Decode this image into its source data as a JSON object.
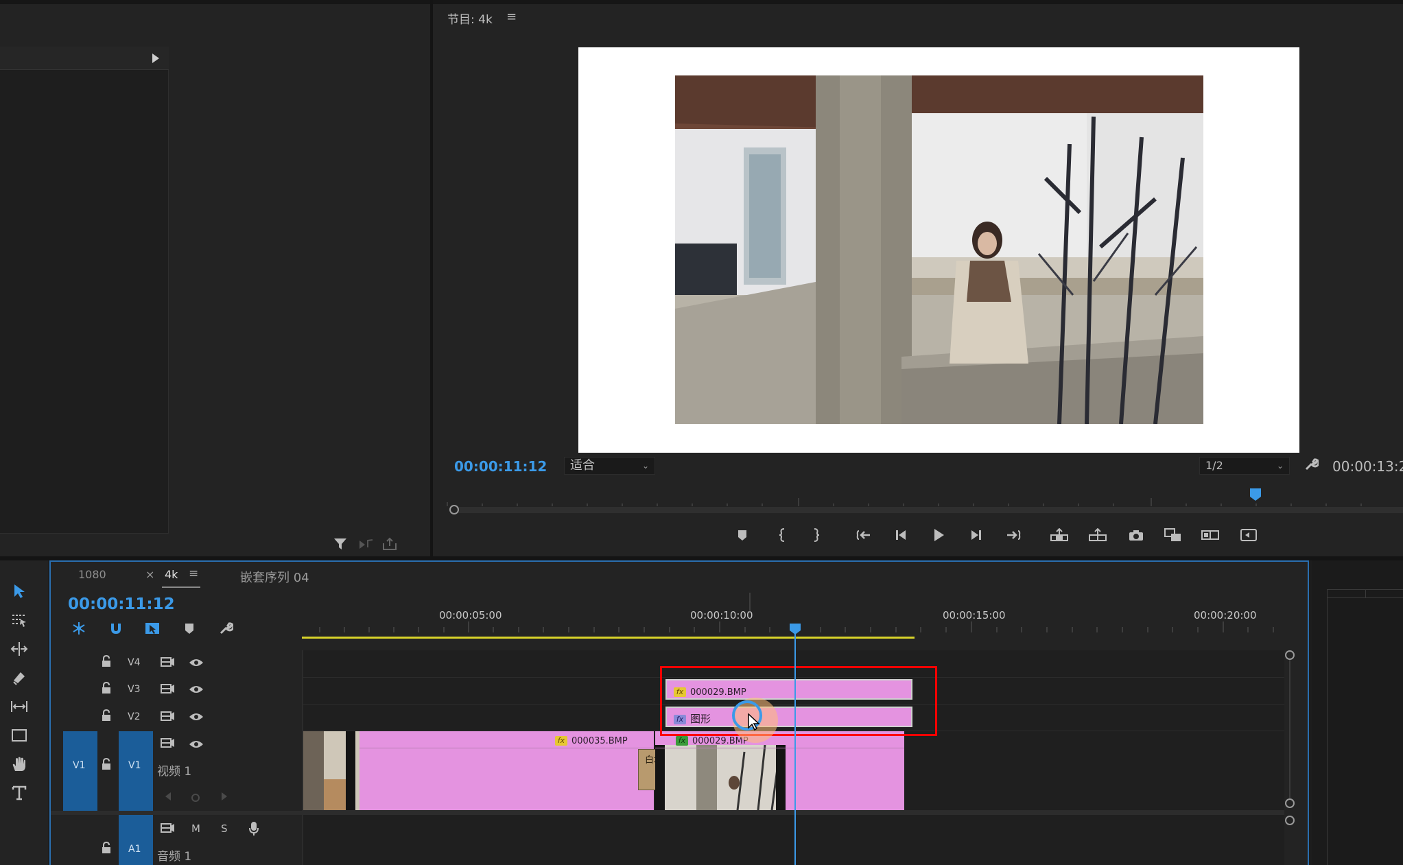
{
  "left_panel": {},
  "program_monitor": {
    "title": "节目: 4k",
    "current_timecode": "00:00:11:12",
    "fit_select": "适合",
    "resolution_select": "1/2",
    "duration_timecode": "00:00:13:2"
  },
  "timeline": {
    "tabs": [
      {
        "label": "1080"
      },
      {
        "label": "4k",
        "close": "×"
      },
      {
        "label": "嵌套序列 04"
      }
    ],
    "current_timecode": "00:00:11:12",
    "ruler_labels": [
      "00:00:05:00",
      "00:00:10:00",
      "00:00:15:00",
      "00:00:20:00"
    ],
    "tracks": [
      {
        "id": "V4",
        "label": "V4"
      },
      {
        "id": "V3",
        "label": "V3"
      },
      {
        "id": "V2",
        "label": "V2"
      },
      {
        "id": "V1",
        "label": "V1",
        "source": "V1",
        "name": "视频 1"
      },
      {
        "id": "A1",
        "label": "A1",
        "name": "音频 1",
        "mute": "M",
        "solo": "S"
      }
    ],
    "clips": {
      "v3": {
        "label": "000029.BMP",
        "fx": "fx"
      },
      "v2": {
        "label": "图形",
        "fx": "fx"
      },
      "v1a": {
        "label": "000035.BMP",
        "fx": "fx"
      },
      "v1b": {
        "label": "000029.BMP",
        "fx": "fx"
      },
      "transition": {
        "label": "白场"
      }
    }
  },
  "colors": {
    "accent_blue": "#3b9ae8",
    "clip_pink": "#e493e0",
    "highlight_red": "#ff0000",
    "work_area_yellow": "#d8d32a"
  }
}
